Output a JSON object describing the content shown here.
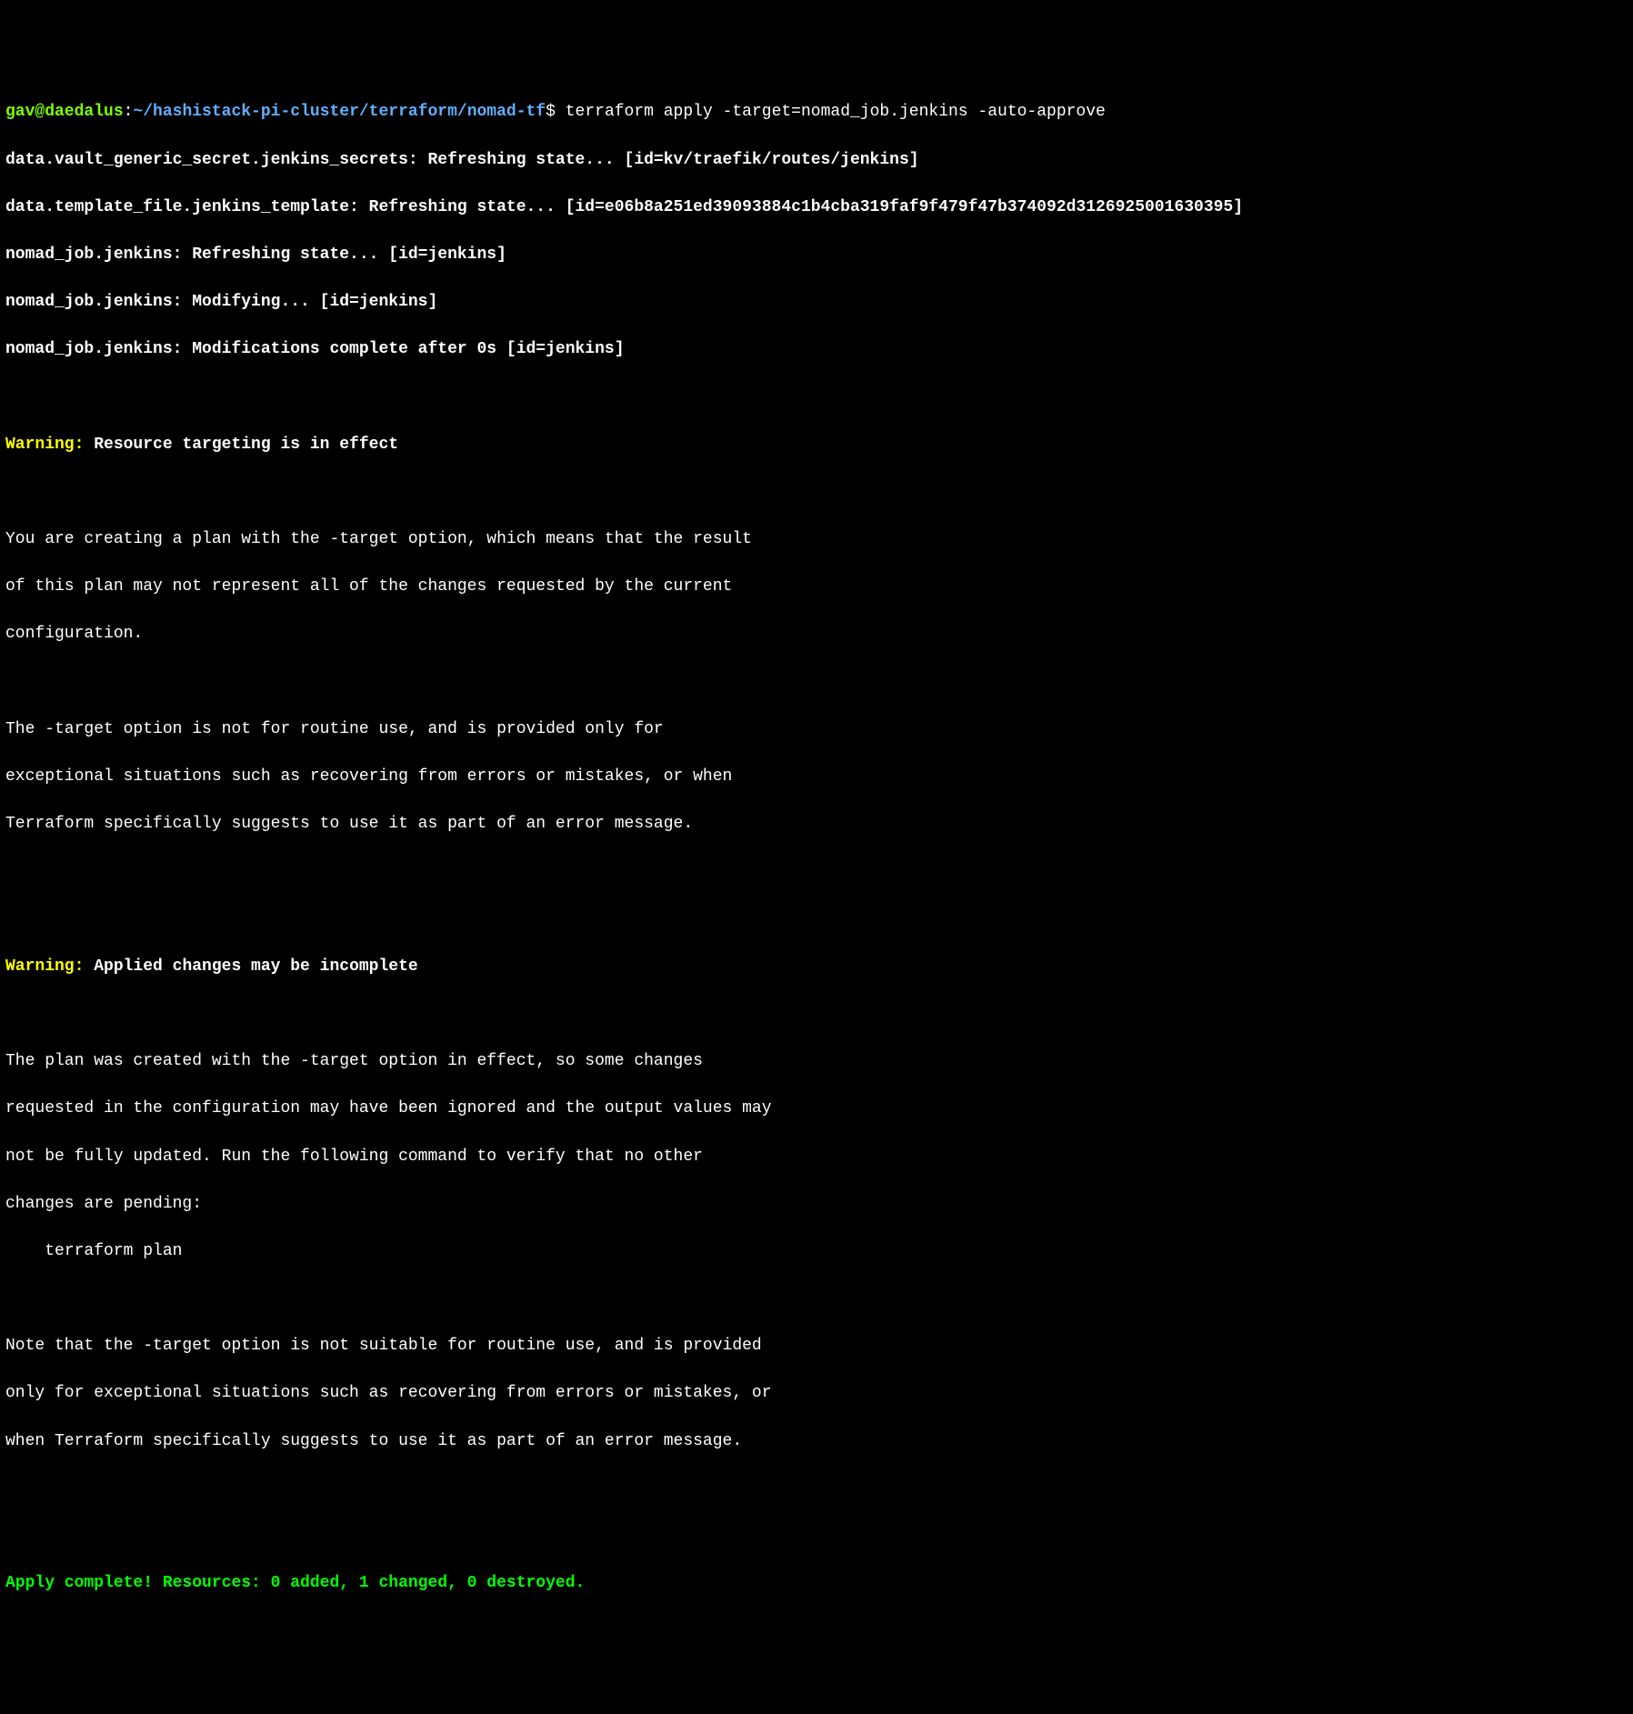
{
  "prompt": {
    "user": "gav@daedalus",
    "colon": ":",
    "path": "~/hashistack-pi-cluster/terraform/nomad-tf",
    "dollar": "$",
    "command": " terraform apply -target=nomad_job.jenkins -auto-approve"
  },
  "output": {
    "line1": "data.vault_generic_secret.jenkins_secrets: Refreshing state... [id=kv/traefik/routes/jenkins]",
    "line2": "data.template_file.jenkins_template: Refreshing state... [id=e06b8a251ed39093884c1b4cba319faf9f479f47b374092d3126925001630395]",
    "line3": "nomad_job.jenkins: Refreshing state... [id=jenkins]",
    "line4": "nomad_job.jenkins: Modifying... [id=jenkins]",
    "line5": "nomad_job.jenkins: Modifications complete after 0s [id=jenkins]"
  },
  "warning1": {
    "label": "Warning:",
    "title": " Resource targeting is in effect",
    "body1": "You are creating a plan with the -target option, which means that the result",
    "body2": "of this plan may not represent all of the changes requested by the current",
    "body3": "configuration.",
    "body4": "The -target option is not for routine use, and is provided only for",
    "body5": "exceptional situations such as recovering from errors or mistakes, or when",
    "body6": "Terraform specifically suggests to use it as part of an error message."
  },
  "warning2": {
    "label": "Warning:",
    "title": " Applied changes may be incomplete",
    "body1": "The plan was created with the -target option in effect, so some changes",
    "body2": "requested in the configuration may have been ignored and the output values may",
    "body3": "not be fully updated. Run the following command to verify that no other",
    "body4": "changes are pending:",
    "body5": "    terraform plan",
    "body6": "Note that the -target option is not suitable for routine use, and is provided",
    "body7": "only for exceptional situations such as recovering from errors or mistakes, or",
    "body8": "when Terraform specifically suggests to use it as part of an error message."
  },
  "apply": {
    "complete": "Apply complete! Resources: 0 added, 1 changed, 0 destroyed."
  }
}
